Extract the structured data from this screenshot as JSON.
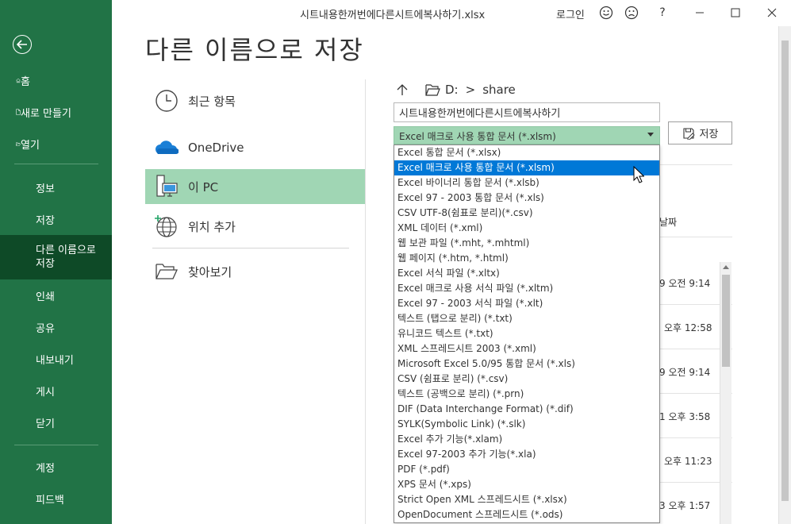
{
  "window": {
    "title": "시트내용한꺼번에다른시트에복사하기.xlsx",
    "login": "로그인",
    "help": "?"
  },
  "backstage": {
    "items": [
      {
        "label": "홈",
        "icon": "home-icon"
      },
      {
        "label": "새로 만들기",
        "icon": "new-file-icon"
      },
      {
        "label": "열기",
        "icon": "folder-open-icon"
      },
      {
        "label": "정보"
      },
      {
        "label": "저장"
      },
      {
        "label": "다른 이름으로 저장",
        "active": true
      },
      {
        "label": "인쇄"
      },
      {
        "label": "공유"
      },
      {
        "label": "내보내기"
      },
      {
        "label": "게시"
      },
      {
        "label": "닫기"
      },
      {
        "label": "계정"
      },
      {
        "label": "피드백"
      }
    ]
  },
  "page": {
    "title": "다른 이름으로 저장"
  },
  "locations": [
    {
      "label": "최근 항목",
      "icon": "clock-icon"
    },
    {
      "label": "OneDrive",
      "icon": "cloud-icon"
    },
    {
      "label": "이 PC",
      "icon": "pc-icon",
      "active": true
    },
    {
      "label": "위치 추가",
      "icon": "globe-add-icon"
    },
    {
      "label": "찾아보기",
      "icon": "folder-icon"
    }
  ],
  "path": {
    "drive": "D:",
    "separator": ">",
    "folder": "share"
  },
  "filename": {
    "value": "시트내용한꺼번에다른시트에복사하기"
  },
  "file_type": {
    "selected": "Excel 매크로 사용 통합 문서 (*.xlsm)",
    "options": [
      "Excel 통합 문서 (*.xlsx)",
      "Excel 매크로 사용 통합 문서 (*.xlsm)",
      "Excel 바이너리 통합 문서 (*.xlsb)",
      "Excel 97 - 2003 통합 문서 (*.xls)",
      "CSV UTF-8(쉼표로 분리)(*.csv)",
      "XML 데이터 (*.xml)",
      "웹 보관 파일 (*.mht, *.mhtml)",
      "웹 페이지 (*.htm, *.html)",
      "Excel 서식 파일 (*.xltx)",
      "Excel 매크로 사용 서식 파일 (*.xltm)",
      "Excel 97 - 2003 서식 파일 (*.xlt)",
      "텍스트 (탭으로 분리) (*.txt)",
      "유니코드 텍스트 (*.txt)",
      "XML 스프레드시트 2003 (*.xml)",
      "Microsoft Excel 5.0/95 통합 문서 (*.xls)",
      "CSV (쉼표로 분리) (*.csv)",
      "텍스트 (공백으로 분리) (*.prn)",
      "DIF (Data Interchange Format) (*.dif)",
      "SYLK(Symbolic Link) (*.slk)",
      "Excel 추가 기능(*.xlam)",
      "Excel 97-2003 추가 기능(*.xla)",
      "PDF (*.pdf)",
      "XPS 문서 (*.xps)",
      "Strict Open XML 스프레드시트 (*.xlsx)",
      "OpenDocument 스프레드시트 (*.ods)"
    ],
    "highlighted_index": 1
  },
  "save_button": {
    "label": "저장"
  },
  "background_list": {
    "column_fragment": "날짜",
    "dates": [
      "9 오전 9:14",
      "오후 12:58",
      "9 오전 9:14",
      "1 오후 3:58",
      "오후 11:23",
      "3 오후 1:57"
    ]
  },
  "colors": {
    "backstage_green": "#217346",
    "active_nav": "#0e4a27",
    "highlight": "#a0d6b4",
    "selection_blue": "#0078d7"
  }
}
